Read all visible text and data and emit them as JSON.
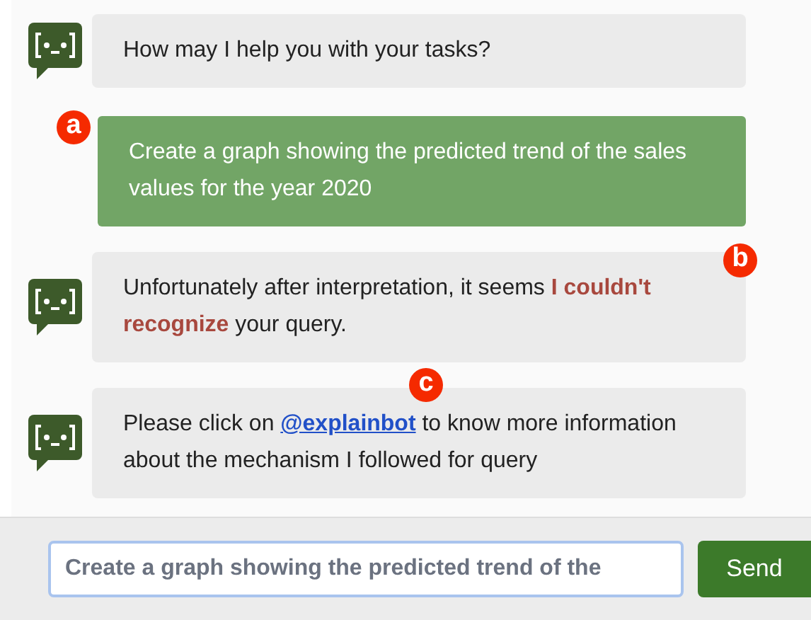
{
  "messages": [
    {
      "kind": "bot",
      "segments": [
        {
          "kind": "text",
          "text": "How may I help you with your tasks?"
        }
      ]
    },
    {
      "kind": "user",
      "badge": "a",
      "segments": [
        {
          "kind": "text",
          "text": "Create a graph showing the predicted trend of the sales values for the year 2020"
        }
      ]
    },
    {
      "kind": "bot",
      "badge": "b",
      "segments": [
        {
          "kind": "text",
          "text": "Unfortunately after interpretation, it seems "
        },
        {
          "kind": "emphasis",
          "text": "I couldn't recognize"
        },
        {
          "kind": "text",
          "text": " your query."
        }
      ]
    },
    {
      "kind": "bot",
      "badge": "c",
      "segments": [
        {
          "kind": "text",
          "text": "Please click on "
        },
        {
          "kind": "link",
          "text": "@explainbot"
        },
        {
          "kind": "text",
          "text": " to know more information about the mechanism I followed for query"
        }
      ]
    }
  ],
  "composer": {
    "value": "Create a graph showing the predicted trend of the",
    "button": "Send"
  }
}
